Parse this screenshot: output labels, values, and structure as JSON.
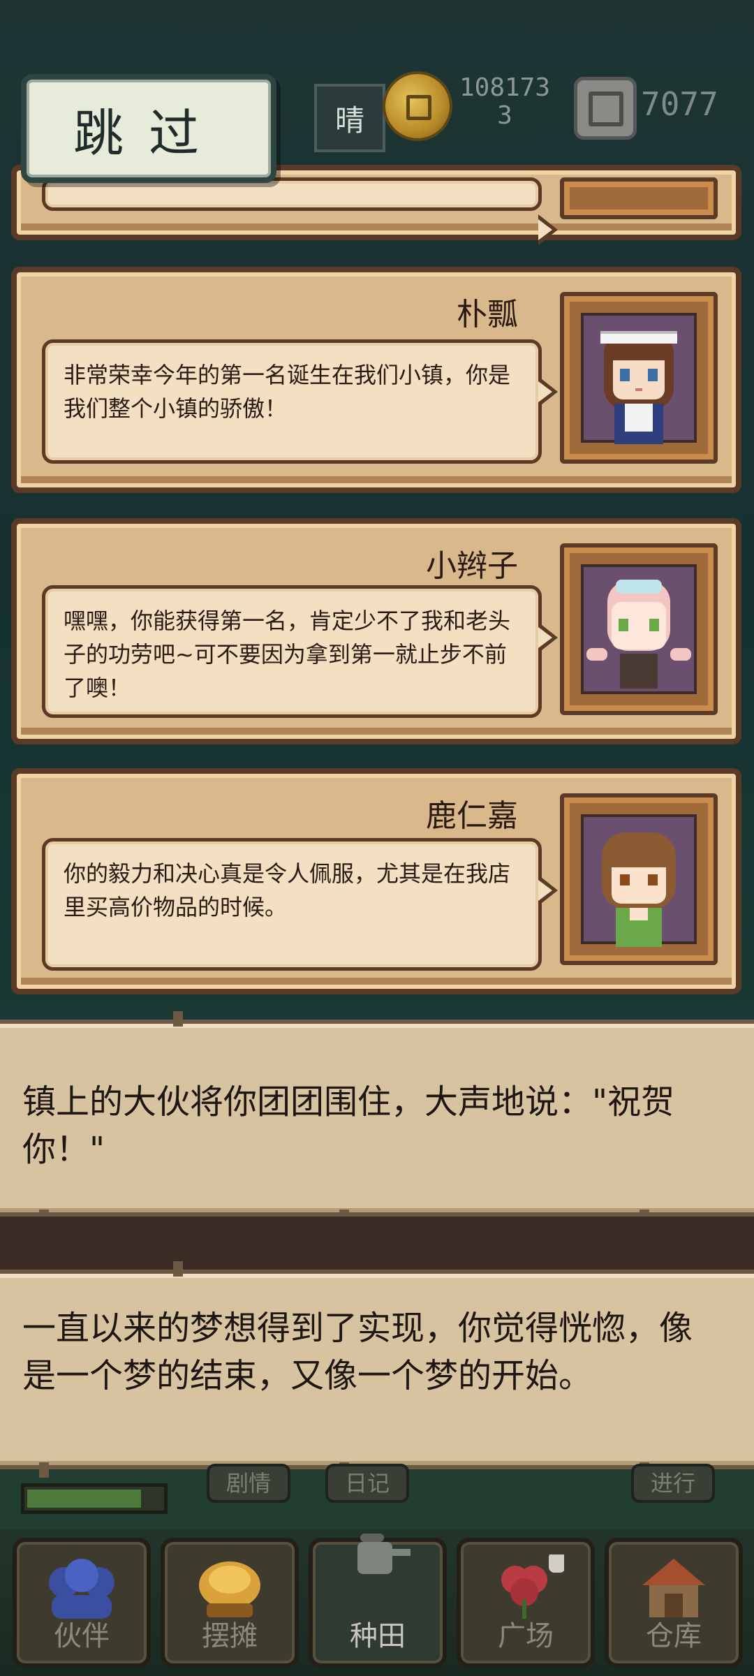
{
  "skip_button": {
    "label": "跳过"
  },
  "top_bar": {
    "weather": "晴",
    "coins": "1081733",
    "gems": "7077"
  },
  "cards": [
    {
      "speaker": "朴瓢",
      "message": "非常荣幸今年的第一名诞生在我们小镇，你是我们整个小镇的骄傲！",
      "portrait": "maid-girl-portrait-icon"
    },
    {
      "speaker": "小辫子",
      "message": "嘿嘿，你能获得第一名，肯定少不了我和老头子的功劳吧~可不要因为拿到第一就止步不前了噢！",
      "portrait": "twin-tail-girl-portrait-icon"
    },
    {
      "speaker": "鹿仁嘉",
      "message": "你的毅力和决心真是令人佩服，尤其是在我店里买高价物品的时候。",
      "portrait": "bob-hair-girl-portrait-icon"
    }
  ],
  "narration": [
    {
      "text": "镇上的大伙将你团团围住，大声地说：\"祝贺你！\""
    },
    {
      "text": "一直以来的梦想得到了实现，你觉得恍惚，像是一个梦的结束，又像一个梦的开始。"
    }
  ],
  "bottom_buttons": {
    "story": "剧情",
    "diary": "日记",
    "proceed": "进行"
  },
  "progress": {
    "fraction": 0.85
  },
  "nav": [
    {
      "label": "伙伴",
      "icon": "companion-icon"
    },
    {
      "label": "摆摊",
      "icon": "stall-icon"
    },
    {
      "label": "种田",
      "icon": "watering-can-icon",
      "active": true
    },
    {
      "label": "广场",
      "icon": "plaza-flower-icon"
    },
    {
      "label": "仓库",
      "icon": "warehouse-icon"
    }
  ],
  "colors": {
    "card_bg": "#d9b88b",
    "bubble_bg": "#f3dfc1",
    "narration_bg": "#d8c3a0",
    "skip_bg": "#e6ecd9"
  }
}
